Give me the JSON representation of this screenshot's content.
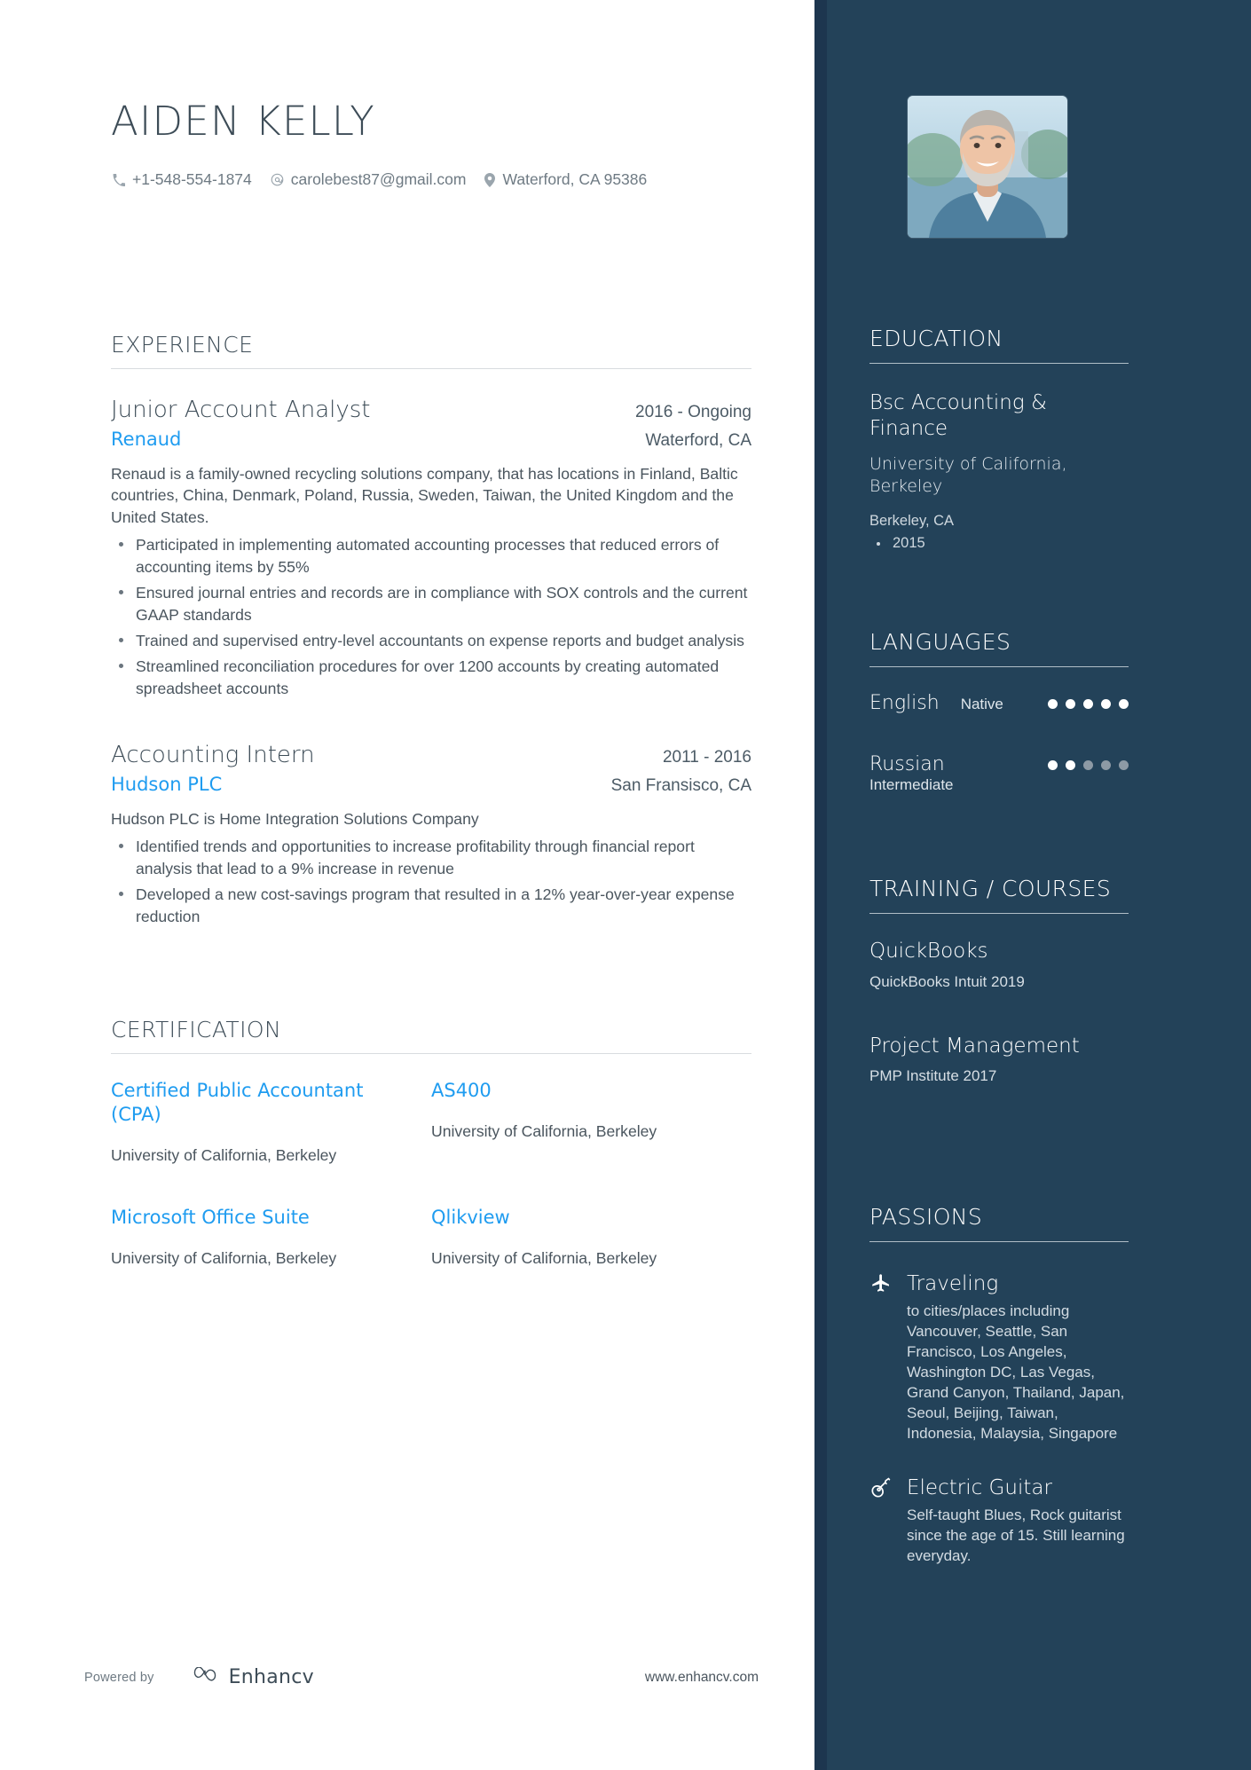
{
  "header": {
    "name": "AIDEN KELLY",
    "contacts": [
      {
        "icon": "phone-icon",
        "text": "+1-548-554-1874"
      },
      {
        "icon": "email-icon",
        "text": "carolebest87@gmail.com"
      },
      {
        "icon": "location-pin-icon",
        "text": "Waterford, CA 95386"
      }
    ]
  },
  "experience": {
    "heading": "EXPERIENCE",
    "jobs": [
      {
        "title": "Junior Account Analyst",
        "date": "2016 - Ongoing",
        "company": "Renaud",
        "location": "Waterford, CA",
        "description": "Renaud is a family-owned recycling solutions company, that has locations in Finland, Baltic countries, China, Denmark, Poland, Russia, Sweden, Taiwan, the United Kingdom and the United States.",
        "bullets": [
          "Participated in implementing automated accounting processes that reduced errors of accounting items by 55%",
          "Ensured journal entries and records are in compliance with SOX controls and the current GAAP standards",
          "Trained and supervised entry-level accountants on expense reports and budget analysis",
          "Streamlined reconciliation procedures for over 1200 accounts by creating automated spreadsheet accounts"
        ]
      },
      {
        "title": "Accounting Intern",
        "date": "2011 - 2016",
        "company": "Hudson PLC",
        "location": "San Fransisco, CA",
        "description": "Hudson PLC is Home Integration Solutions Company",
        "bullets": [
          "Identified trends and opportunities to increase profitability through financial report analysis that lead to a 9% increase in revenue",
          "Developed a new cost-savings program that resulted in a 12% year-over-year expense reduction"
        ]
      }
    ]
  },
  "certification": {
    "heading": "CERTIFICATION",
    "items": [
      {
        "name": "Certified Public Accountant (CPA)",
        "org": "University of California, Berkeley"
      },
      {
        "name": "AS400",
        "org": "University of California, Berkeley"
      },
      {
        "name": "Microsoft Office Suite",
        "org": "University of California, Berkeley"
      },
      {
        "name": "Qlikview",
        "org": "University of California, Berkeley"
      }
    ]
  },
  "education": {
    "heading": "EDUCATION",
    "degree": "Bsc Accounting & Finance",
    "school": "University of California, Berkeley",
    "location": "Berkeley, CA",
    "years": [
      "2015"
    ]
  },
  "languages": {
    "heading": "LANGUAGES",
    "items": [
      {
        "name": "English",
        "level": "Native",
        "filled": 5,
        "total": 5,
        "inline": true
      },
      {
        "name": "Russian",
        "level": "Intermediate",
        "filled": 2,
        "total": 5,
        "inline": false
      }
    ]
  },
  "training": {
    "heading": "TRAINING / COURSES",
    "items": [
      {
        "name": "QuickBooks",
        "org": "QuickBooks Intuit 2019"
      },
      {
        "name": "Project Management",
        "org": "PMP Institute 2017"
      }
    ]
  },
  "passions": {
    "heading": "PASSIONS",
    "items": [
      {
        "icon": "airplane-icon",
        "title": "Traveling",
        "description": "to cities/places including Vancouver, Seattle, San Francisco, Los Angeles, Washington DC, Las Vegas, Grand Canyon, Thailand, Japan, Seoul, Beijing, Taiwan, Indonesia, Malaysia, Singapore"
      },
      {
        "icon": "guitar-icon",
        "title": "Electric Guitar",
        "description": "Self-taught Blues, Rock guitarist since the age of 15. Still learning everyday."
      }
    ]
  },
  "footer": {
    "powered_by": "Powered by",
    "brand": "Enhancv",
    "website": "www.enhancv.com"
  },
  "colors": {
    "accent_blue": "#1f9cf0",
    "sidebar": "#234259",
    "sidebar_edge": "#1d364f",
    "text_dark": "#3d4c57"
  }
}
